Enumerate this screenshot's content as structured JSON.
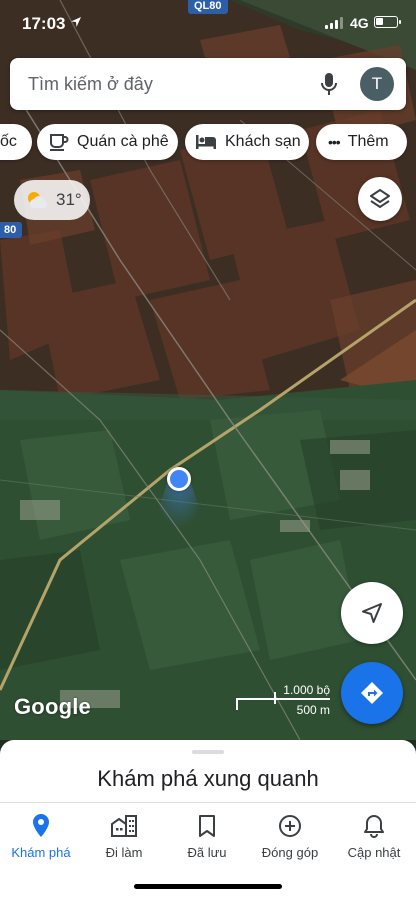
{
  "status_bar": {
    "time": "17:03",
    "network": "4G",
    "battery_level": 0.35
  },
  "map": {
    "road_tag_top": "QL80",
    "road_tag_left": "80",
    "attribution": "Google",
    "scale": {
      "imperial": "1.000 bộ",
      "metric": "500 m"
    }
  },
  "search": {
    "placeholder": "Tìm kiếm ở đây",
    "avatar_letter": "T",
    "mic_icon": "mic-icon"
  },
  "chips": [
    {
      "label": "ốc",
      "icon": "none"
    },
    {
      "label": "Quán cà phê",
      "icon": "coffee-icon"
    },
    {
      "label": "Khách sạn",
      "icon": "hotel-bed-icon"
    },
    {
      "label": "Thêm",
      "icon": "more-dots-icon"
    }
  ],
  "weather": {
    "temperature": "31°",
    "icon": "partly-cloudy-icon"
  },
  "bottom_sheet": {
    "title": "Khám phá xung quanh"
  },
  "nav": {
    "items": [
      {
        "label": "Khám phá",
        "icon": "location-pin-icon",
        "active": true
      },
      {
        "label": "Đi làm",
        "icon": "commute-buildings-icon",
        "active": false
      },
      {
        "label": "Đã lưu",
        "icon": "bookmark-icon",
        "active": false
      },
      {
        "label": "Đóng góp",
        "icon": "add-circle-icon",
        "active": false
      },
      {
        "label": "Cập nhật",
        "icon": "bell-icon",
        "active": false
      }
    ]
  },
  "colors": {
    "accent": "#1a73e8",
    "location_dot": "#4285f4",
    "road_tag": "#2d5fa8"
  }
}
